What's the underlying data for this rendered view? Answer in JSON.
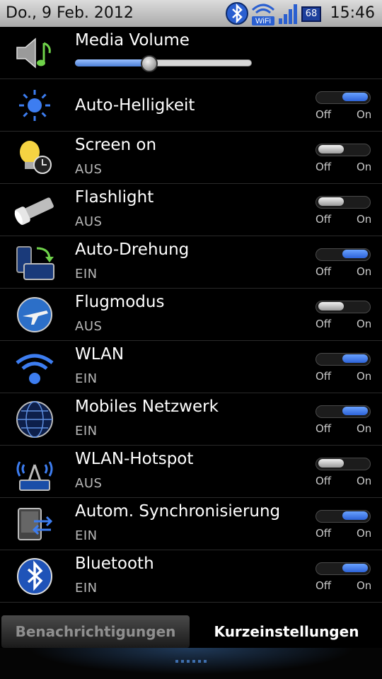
{
  "status_bar": {
    "date": "Do., 9 Feb. 2012",
    "time": "15:46",
    "battery": "68",
    "wifi_label": "WiFi",
    "icons": [
      "bluetooth-icon",
      "wifi-icon",
      "signal-icon",
      "battery-icon"
    ]
  },
  "media_volume": {
    "label": "Media Volume",
    "level_percent": 42
  },
  "toggle_labels": {
    "off": "Off",
    "on": "On"
  },
  "settings": [
    {
      "label": "Auto-Helligkeit",
      "status": "",
      "on": true,
      "icon": "brightness-icon"
    },
    {
      "label": "Screen on",
      "status": "AUS",
      "on": false,
      "icon": "bulb-clock-icon"
    },
    {
      "label": "Flashlight",
      "status": "AUS",
      "on": false,
      "icon": "flashlight-icon"
    },
    {
      "label": "Auto-Drehung",
      "status": "EIN",
      "on": true,
      "icon": "rotation-icon"
    },
    {
      "label": "Flugmodus",
      "status": "AUS",
      "on": false,
      "icon": "airplane-globe-icon"
    },
    {
      "label": "WLAN",
      "status": "EIN",
      "on": true,
      "icon": "wifi-icon"
    },
    {
      "label": "Mobiles Netzwerk",
      "status": "EIN",
      "on": true,
      "icon": "globe-network-icon"
    },
    {
      "label": "WLAN-Hotspot",
      "status": "AUS",
      "on": false,
      "icon": "hotspot-icon"
    },
    {
      "label": "Autom. Synchronisierung",
      "status": "EIN",
      "on": true,
      "icon": "sync-icon"
    },
    {
      "label": "Bluetooth",
      "status": "EIN",
      "on": true,
      "icon": "bluetooth-icon"
    }
  ],
  "tabs": {
    "notifications": "Benachrichtigungen",
    "quick_settings": "Kurzeinstellungen",
    "active": "quick_settings"
  }
}
